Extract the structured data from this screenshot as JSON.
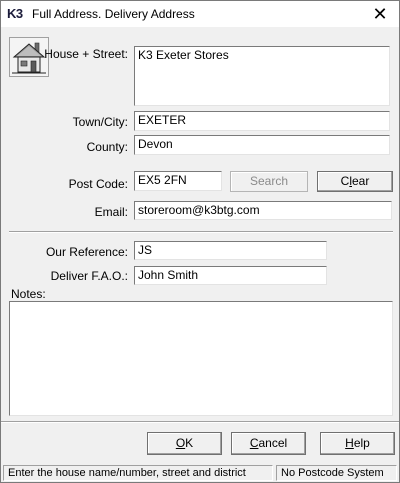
{
  "window": {
    "app_logo": "K3",
    "title": "Full Address.  Delivery Address",
    "close_glyph": "✕"
  },
  "icons": {
    "house": "house-icon"
  },
  "form": {
    "house_street": {
      "label": "House + Street:",
      "value": "K3 Exeter Stores"
    },
    "town": {
      "label": "Town/City:",
      "value": "EXETER"
    },
    "county": {
      "label": "County:",
      "value": "Devon"
    },
    "postcode": {
      "label": "Post Code:",
      "value": "EX5 2FN"
    },
    "email": {
      "label": "Email:",
      "value": "storeroom@k3btg.com"
    },
    "our_reference": {
      "label": "Our Reference:",
      "value": "JS"
    },
    "deliver_fao": {
      "label": "Deliver F.A.O.:",
      "value": "John Smith"
    },
    "notes": {
      "label": "Notes:",
      "value": ""
    }
  },
  "buttons": {
    "search": {
      "label": "Search",
      "enabled": false
    },
    "clear": {
      "pre": "C",
      "mn": "l",
      "post": "ear"
    },
    "ok": {
      "pre": "",
      "mn": "O",
      "post": "K"
    },
    "cancel": {
      "pre": "",
      "mn": "C",
      "post": "ancel"
    },
    "help": {
      "pre": "",
      "mn": "H",
      "post": "elp"
    }
  },
  "status": {
    "hint": "Enter the house name/number, street and district",
    "postcode_system": "No Postcode System"
  }
}
